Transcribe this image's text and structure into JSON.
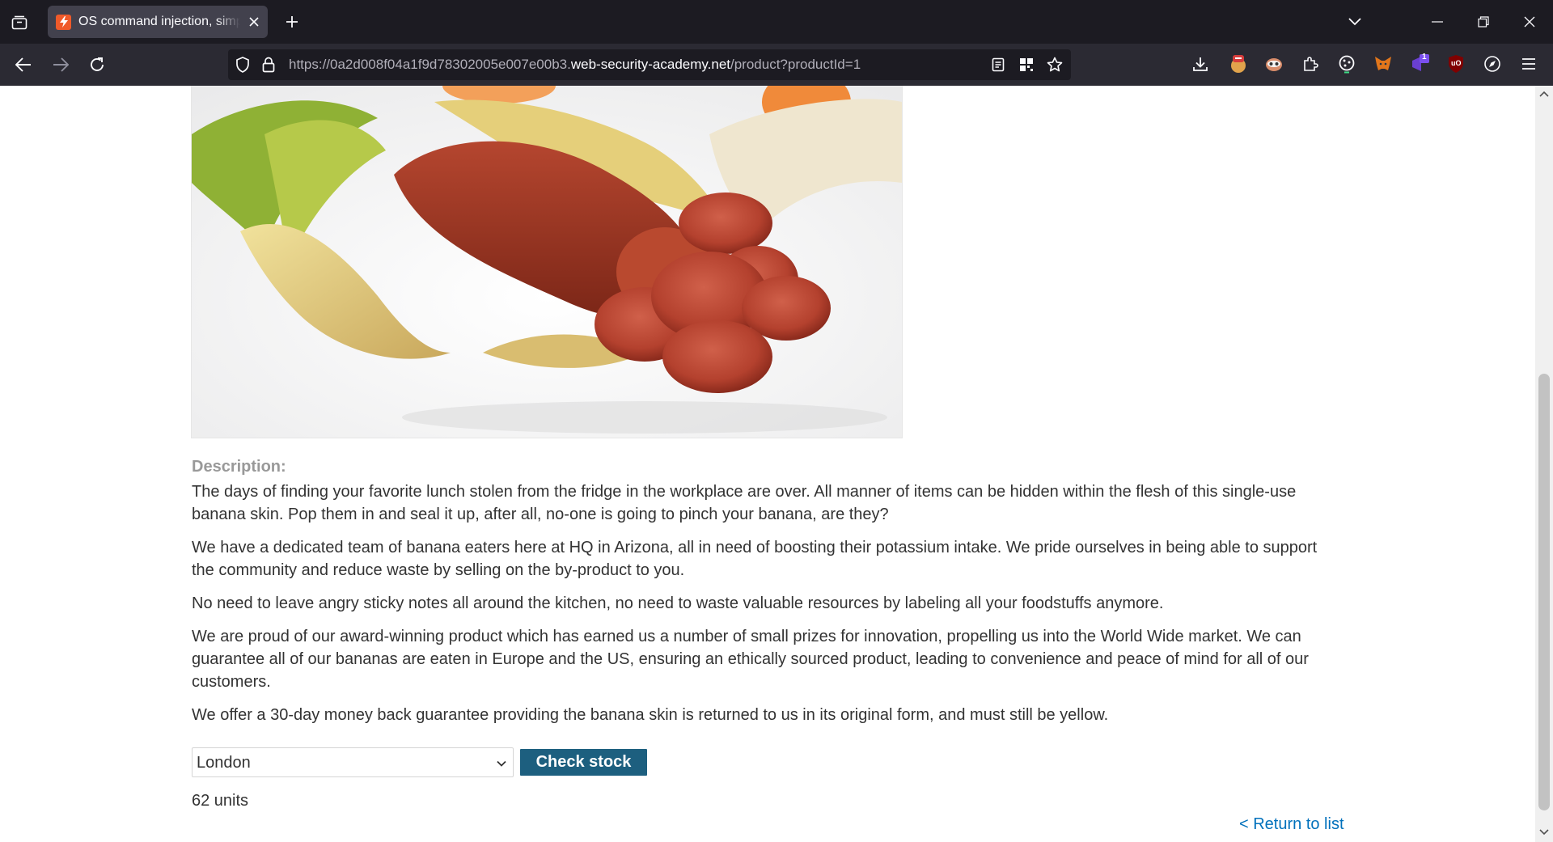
{
  "browser": {
    "tab_title": "OS command injection, simple case",
    "url_prefix": "https://0a2d008f04a1f9d78302005e007e00b3.",
    "url_host": "web-security-academy.net",
    "url_path": "/product?productId=1",
    "extensions": [
      "download-icon",
      "ublock-shield-ext",
      "privacy-badger-ext",
      "extensions-puzzle-icon",
      "cookie-ext",
      "metamask-ext",
      "notification-ext",
      "ublock-origin-ext",
      "compass-ext",
      "menu-icon"
    ],
    "extension_badge": "1",
    "ublock_label": "uO",
    "accent_tab_favicon": "#ef5a2a"
  },
  "product": {
    "image_alt": "banana skin with chorizo sausage",
    "description_label": "Description:",
    "paragraphs": [
      "The days of finding your favorite lunch stolen from the fridge in the workplace are over. All manner of items can be hidden within the flesh of this single-use banana skin. Pop them in and seal it up, after all, no-one is going to pinch your banana, are they?",
      "We have a dedicated team of banana eaters here at HQ in Arizona, all in need of boosting their potassium intake. We pride ourselves in being able to support the community and reduce waste by selling on the by-product to you.",
      "No need to leave angry sticky notes all around the kitchen, no need to waste valuable resources by labeling all your foodstuffs anymore.",
      "We are proud of our award-winning product which has earned us a number of small prizes for innovation, propelling us into the World Wide market. We can guarantee all of our bananas are eaten in Europe and the US, ensuring an ethically sourced product, leading to convenience and peace of mind for all of our customers.",
      "We offer a 30-day money back guarantee providing the banana skin is returned to us in its original form, and must still be yellow."
    ]
  },
  "stock": {
    "selected_store": "London",
    "check_button": "Check stock",
    "result": "62 units"
  },
  "nav": {
    "return_link": "< Return to list"
  },
  "colors": {
    "button": "#1d5f7f",
    "link": "#0071bc",
    "label": "#999999"
  }
}
